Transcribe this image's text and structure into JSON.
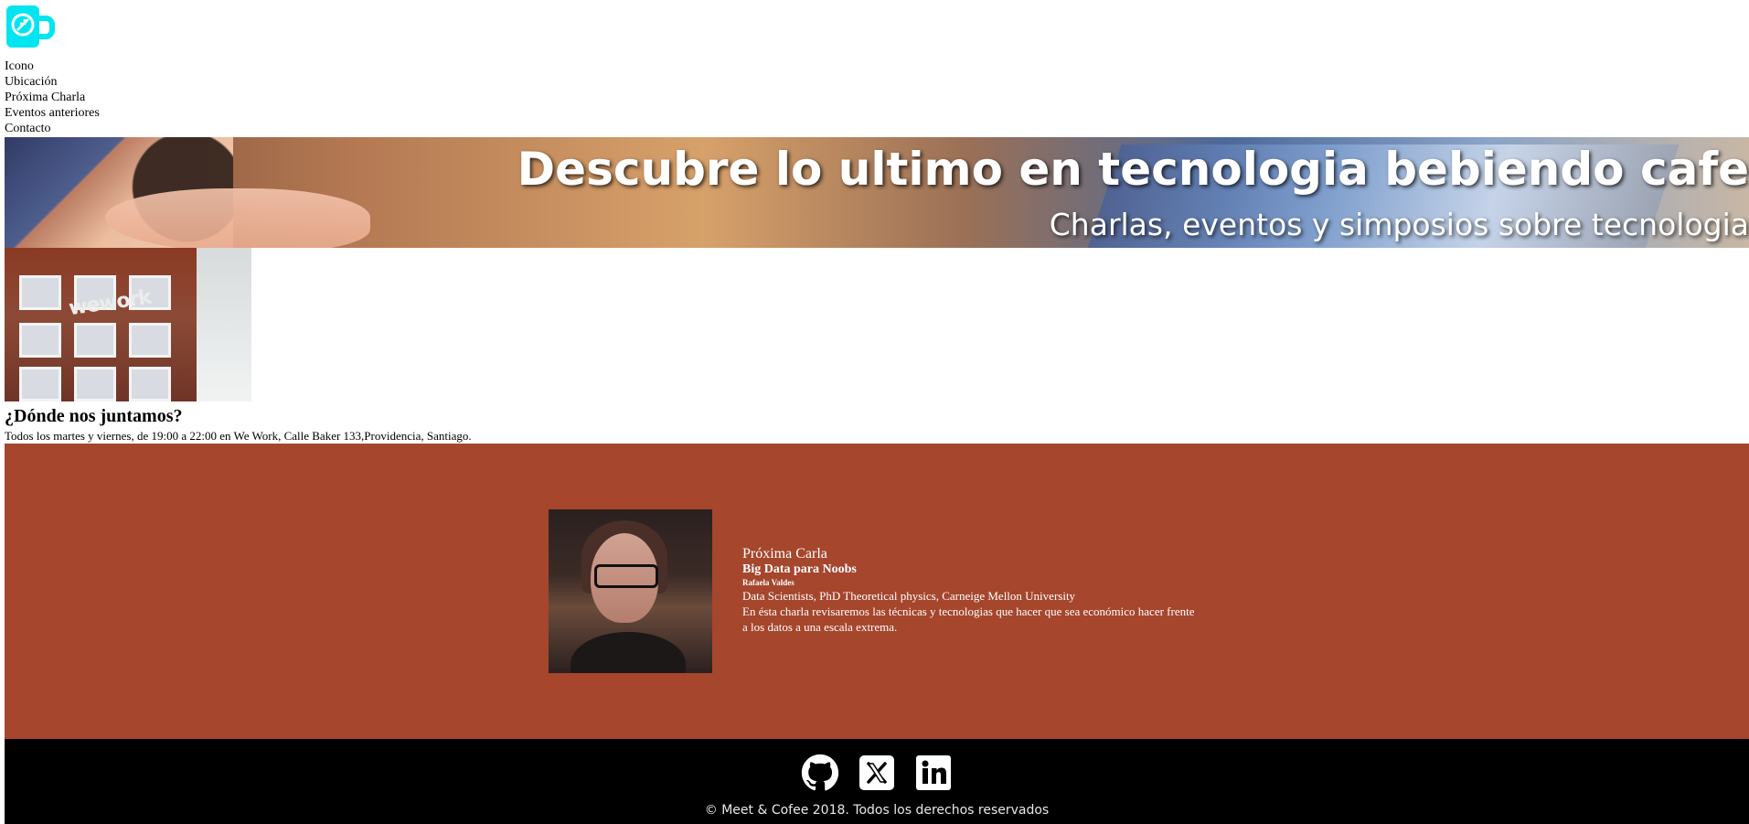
{
  "nav": {
    "items": [
      "Icono",
      "Ubicación",
      "Próxima Charla",
      "Eventos anteriores",
      "Contacto"
    ]
  },
  "hero": {
    "title": "Descubre lo ultimo en tecnologia bebiendo cafe",
    "subtitle": "Charlas, eventos y simposios sobre tecnologia"
  },
  "location": {
    "photo_sign": "wework",
    "title": "¿Dónde nos juntamos?",
    "text": "Todos los martes y viernes, de 19:00 a 22:00 en We Work, Calle Baker 133,Providencia, Santiago."
  },
  "next_talk": {
    "label": "Próxima Carla",
    "title": "Big Data para Noobs",
    "speaker": "Rafaela Valdes",
    "role": "Data Scientists, PhD Theoretical physics, Carneige Mellon University",
    "description": "En ésta charla revisaremos las técnicas y tecnologias que hacer que sea económico hacer frente a los datos a una escala extrema."
  },
  "footer": {
    "social_icons": [
      "github-icon",
      "x-icon",
      "linkedin-icon"
    ],
    "copyright": "© Meet & Cofee 2018. Todos los derechos reservados"
  },
  "colors": {
    "logo": "#00e5ef",
    "talk_background": "#a5462d",
    "footer_background": "#000000",
    "hero_text": "#ffffff"
  }
}
